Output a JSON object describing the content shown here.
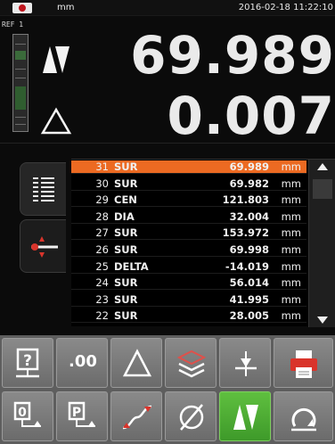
{
  "status": {
    "unit": "mm",
    "datetime": "2016-02-18 11:22:10"
  },
  "ref_label": "REF 1",
  "readouts": {
    "value": "69.989",
    "delta": "0.007",
    "value_symbol": "▲▼",
    "delta_symbol": "△"
  },
  "measurements": [
    {
      "num": "31",
      "type": "SUR",
      "value": "69.989",
      "unit": "mm",
      "selected": true
    },
    {
      "num": "30",
      "type": "SUR",
      "value": "69.982",
      "unit": "mm"
    },
    {
      "num": "29",
      "type": "CEN",
      "value": "121.803",
      "unit": "mm"
    },
    {
      "num": "28",
      "type": "DIA",
      "value": "32.004",
      "unit": "mm"
    },
    {
      "num": "27",
      "type": "SUR",
      "value": "153.972",
      "unit": "mm"
    },
    {
      "num": "26",
      "type": "SUR",
      "value": "69.998",
      "unit": "mm"
    },
    {
      "num": "25",
      "type": "DELTA",
      "value": "-14.019",
      "unit": "mm"
    },
    {
      "num": "24",
      "type": "SUR",
      "value": "56.014",
      "unit": "mm"
    },
    {
      "num": "23",
      "type": "SUR",
      "value": "41.995",
      "unit": "mm"
    },
    {
      "num": "22",
      "type": "SUR",
      "value": "28.005",
      "unit": "mm"
    }
  ],
  "toolbar": {
    "decimals_label": ".00",
    "delta_icon": "delta-icon",
    "layers_icon": "layers-icon",
    "probe_icon": "probe-down-icon",
    "print_icon": "printer-icon",
    "ref0_label": "0",
    "refP_label": "P",
    "curve_icon": "curve-icon",
    "diameter_icon": "diameter-icon",
    "mode_icon": "up-down-arrows-icon",
    "rotate_icon": "rotation-icon"
  },
  "colors": {
    "selected_row": "#ec6a22",
    "active_button": "#4aa932",
    "background": "#0b0b0b"
  }
}
